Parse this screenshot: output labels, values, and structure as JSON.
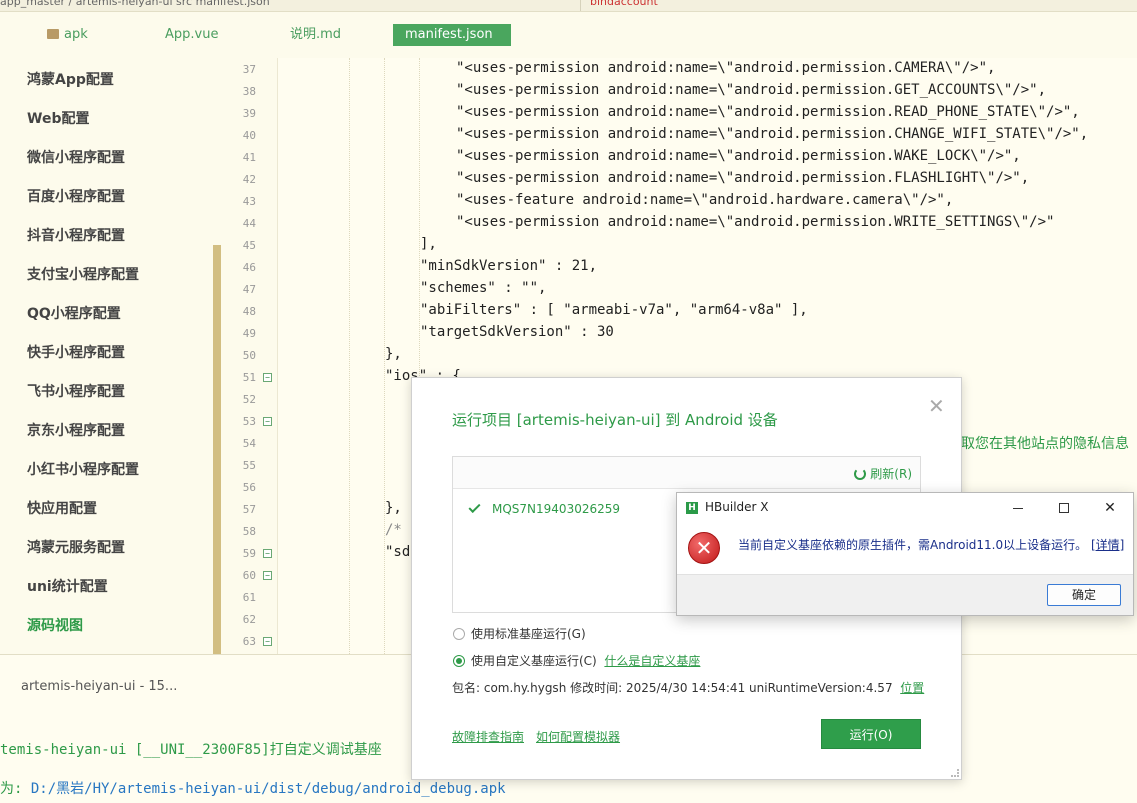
{
  "top_strip": {
    "breadcrumb": "app_master / artemis-heiyan-ui    src    manifest.json",
    "right_tab": "bindaccount"
  },
  "file_tabs": [
    {
      "label": "apk"
    },
    {
      "label": "App.vue"
    },
    {
      "label": "说明.md"
    },
    {
      "label": "manifest.json"
    }
  ],
  "sidebar": {
    "items": [
      {
        "label": "鸿蒙App配置"
      },
      {
        "label": "Web配置"
      },
      {
        "label": "微信小程序配置"
      },
      {
        "label": "百度小程序配置"
      },
      {
        "label": "抖音小程序配置"
      },
      {
        "label": "支付宝小程序配置"
      },
      {
        "label": "QQ小程序配置"
      },
      {
        "label": "快手小程序配置"
      },
      {
        "label": "飞书小程序配置"
      },
      {
        "label": "京东小程序配置"
      },
      {
        "label": "小红书小程序配置"
      },
      {
        "label": "快应用配置"
      },
      {
        "label": "鸿蒙元服务配置"
      },
      {
        "label": "uni统计配置"
      },
      {
        "label": "源码视图"
      }
    ]
  },
  "editor": {
    "line_numbers": [
      "37",
      "38",
      "39",
      "40",
      "41",
      "42",
      "43",
      "44",
      "45",
      "46",
      "47",
      "48",
      "49",
      "50",
      "51",
      "52",
      "53",
      "54",
      "55",
      "56",
      "57",
      "58",
      "59",
      "60",
      "61",
      "62",
      "63"
    ],
    "lines": [
      "\"<uses-permission android:name=\\\"android.permission.CAMERA\\\"/>\",",
      "\"<uses-permission android:name=\\\"android.permission.GET_ACCOUNTS\\\"/>\",",
      "\"<uses-permission android:name=\\\"android.permission.READ_PHONE_STATE\\\"/>\",",
      "\"<uses-permission android:name=\\\"android.permission.CHANGE_WIFI_STATE\\\"/>\",",
      "\"<uses-permission android:name=\\\"android.permission.WAKE_LOCK\\\"/>\",",
      "\"<uses-permission android:name=\\\"android.permission.FLASHLIGHT\\\"/>\",",
      "\"<uses-feature android:name=\\\"android.hardware.camera\\\"/>\",",
      "\"<uses-permission android:name=\\\"android.permission.WRITE_SETTINGS\\\"/>\"",
      "],",
      "\"minSdkVersion\" : 21,",
      "\"schemes\" : \"\",",
      "\"abiFilters\" : [ \"armeabi-v7a\", \"arm64-v8a\" ],",
      "\"targetSdkVersion\" : 30",
      "},",
      "\"ios\" : {",
      "},",
      "/*",
      "\"sd",
      "取您在其他站点的隐私信息"
    ]
  },
  "console": {
    "tab_label": "artemis-heiyan-ui - 15...",
    "line1": "temis-heiyan-ui [__UNI__2300F85]打自定义调试基座",
    "line2_prefix": "为: ",
    "line2_path": "D:/黑岩/HY/artemis-heiyan-ui/dist/debug/android_debug.apk"
  },
  "run_dialog": {
    "title": "运行项目 [artemis-heiyan-ui] 到 Android 设备",
    "refresh_label": "刷新(R)",
    "device": "MQS7N19403026259",
    "option_standard": "使用标准基座运行(G)",
    "option_custom": "使用自定义基座运行(C)",
    "custom_link": "什么是自定义基座",
    "meta_prefix": "包名:   com.hy.hygsh   修改时间:  2025/4/30 14:54:41   uniRuntimeVersion:4.57",
    "location_link": "位置",
    "help_troubleshoot": "故障排查指南",
    "help_emulator": "如何配置模拟器",
    "run_button": "运行(O)"
  },
  "alert": {
    "title": "HBuilder X",
    "app_icon_letter": "H",
    "message": "当前自定义基座依赖的原生插件，需Android11.0以上设备运行。",
    "details_link": "[详情]",
    "ok_button": "确定",
    "error_symbol": "✕"
  }
}
